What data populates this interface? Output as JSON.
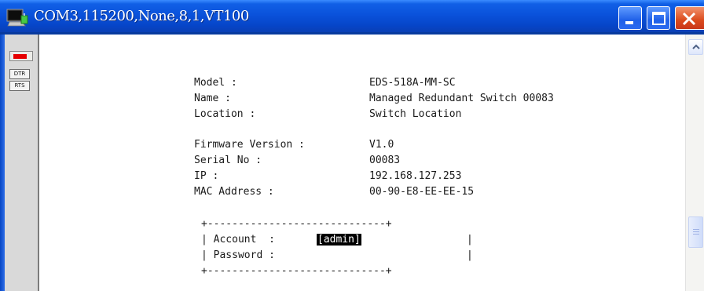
{
  "window": {
    "title": "COM3,115200,None,8,1,VT100",
    "controls": {
      "minimize_icon": "minimize-icon",
      "maximize_icon": "maximize-icon",
      "close_icon": "close-icon"
    },
    "accent_color": "#0a52db",
    "close_color": "#db4b1d"
  },
  "toolbar": {
    "dtr_label": "DTR",
    "rts_label": "RTS",
    "led_color": "#e60000"
  },
  "terminal": {
    "info": [
      {
        "label": "Model :",
        "value": "EDS-518A-MM-SC"
      },
      {
        "label": "Name :",
        "value": "Managed Redundant Switch 00083"
      },
      {
        "label": "Location :",
        "value": "Switch Location"
      },
      {
        "label": "Firmware Version :",
        "value": "V1.0"
      },
      {
        "label": "Serial No :",
        "value": "00083"
      },
      {
        "label": "IP :",
        "value": "192.168.127.253"
      },
      {
        "label": "MAC Address :",
        "value": "00-90-E8-EE-EE-15"
      }
    ],
    "login": {
      "border": "+-----------------------------+",
      "account_label": "| Account  : ",
      "account_value": "[admin]",
      "password_label": "| Password :",
      "right_edge": "|"
    }
  }
}
